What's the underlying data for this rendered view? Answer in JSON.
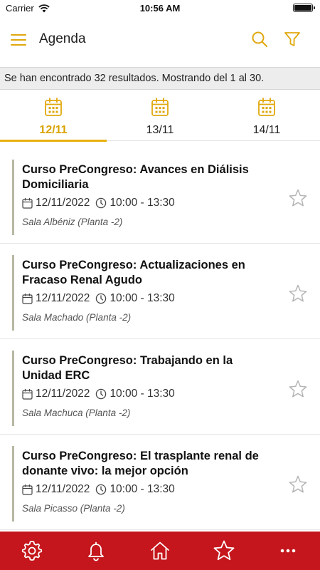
{
  "status_bar": {
    "carrier": "Carrier",
    "time": "10:56 AM"
  },
  "header": {
    "title": "Agenda"
  },
  "results": {
    "text": "Se han encontrado 32 resultados. Mostrando del 1 al 30."
  },
  "date_tabs": [
    {
      "label": "12/11",
      "active": true
    },
    {
      "label": "13/11",
      "active": false
    },
    {
      "label": "14/11",
      "active": false
    }
  ],
  "events": [
    {
      "title": "Curso PreCongreso: Avances en Diálisis Domiciliaria",
      "date": "12/11/2022",
      "time": "10:00 - 13:30",
      "room": "Sala Albéniz (Planta -2)"
    },
    {
      "title": "Curso PreCongreso: Actualizaciones en Fracaso Renal Agudo",
      "date": "12/11/2022",
      "time": "10:00 - 13:30",
      "room": "Sala Machado (Planta -2)"
    },
    {
      "title": "Curso PreCongreso: Trabajando en la Unidad ERC",
      "date": "12/11/2022",
      "time": "10:00 - 13:30",
      "room": "Sala Machuca (Planta -2)"
    },
    {
      "title": "Curso PreCongreso: El trasplante renal de donante vivo: la mejor opción",
      "date": "12/11/2022",
      "time": "10:00 - 13:30",
      "room": "Sala Picasso (Planta -2)"
    }
  ],
  "bottom_nav": [
    "settings-icon",
    "bell-icon",
    "home-icon",
    "star-icon",
    "more-icon"
  ],
  "colors": {
    "accent": "#e8b20e",
    "accent_text": "#d9a300",
    "nav_bg": "#c4161c",
    "event_bar": "#b7b8a4"
  }
}
